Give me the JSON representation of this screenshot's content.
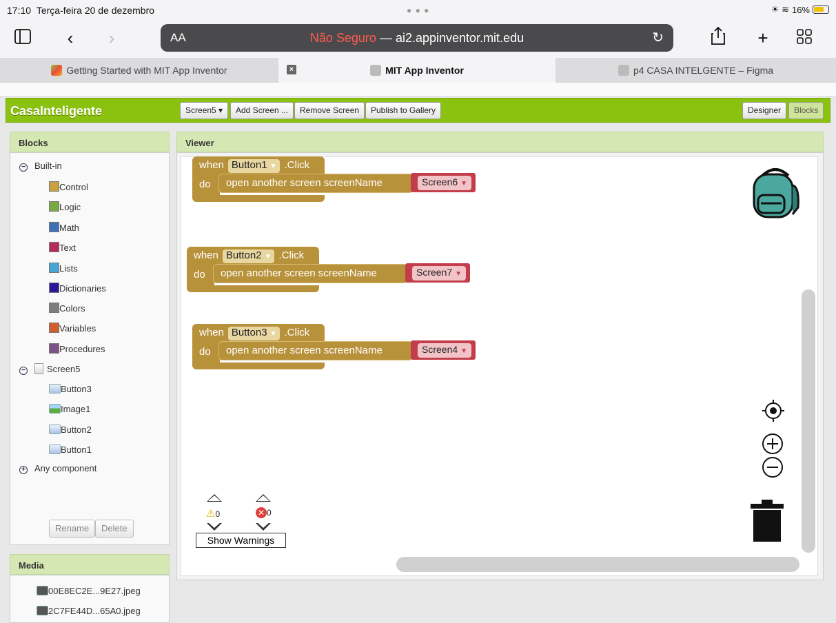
{
  "status_bar": {
    "time": "17:10",
    "date": "Terça-feira 20 de dezembro",
    "battery": "16%"
  },
  "browser": {
    "address_prefix": "AA",
    "not_secure": "Não Seguro",
    "separator": " — ",
    "url": "ai2.appinventor.mit.edu",
    "tabs": [
      {
        "label": "Getting Started with MIT App Inventor"
      },
      {
        "label": "MIT App Inventor"
      },
      {
        "label": "p4 CASA INTELGENTE – Figma"
      }
    ]
  },
  "app": {
    "project_name": "CasaInteligente",
    "screen_selector": "Screen5 ▾",
    "add_screen": "Add Screen ...",
    "remove_screen": "Remove Screen",
    "publish": "Publish to Gallery",
    "designer": "Designer",
    "blocks": "Blocks"
  },
  "blocks_panel": {
    "title": "Blocks",
    "builtin": "Built-in",
    "builtin_items": [
      {
        "label": "Control",
        "color": "#c9a23e"
      },
      {
        "label": "Logic",
        "color": "#77ab41"
      },
      {
        "label": "Math",
        "color": "#3f71b5"
      },
      {
        "label": "Text",
        "color": "#b32d5e"
      },
      {
        "label": "Lists",
        "color": "#49a6d4"
      },
      {
        "label": "Dictionaries",
        "color": "#2d1799"
      },
      {
        "label": "Colors",
        "color": "#7d7d7d"
      },
      {
        "label": "Variables",
        "color": "#d05f2d"
      },
      {
        "label": "Procedures",
        "color": "#7c5385"
      }
    ],
    "screen": "Screen5",
    "components": [
      "Button3",
      "Image1",
      "Button2",
      "Button1"
    ],
    "any_component": "Any component",
    "rename": "Rename",
    "delete": "Delete"
  },
  "media_panel": {
    "title": "Media",
    "files": [
      "00E8EC2E...9E27.jpeg",
      "2C7FE44D...65A0.jpeg"
    ]
  },
  "viewer": {
    "title": "Viewer",
    "blocks": [
      {
        "when": "when",
        "component": "Button1",
        "event": ".Click",
        "do": "do",
        "action": "open another screen  screenName",
        "screen": "Screen6"
      },
      {
        "when": "when",
        "component": "Button2",
        "event": ".Click",
        "do": "do",
        "action": "open another screen  screenName",
        "screen": "Screen7"
      },
      {
        "when": "when",
        "component": "Button3",
        "event": ".Click",
        "do": "do",
        "action": "open another screen  screenName",
        "screen": "Screen4"
      }
    ],
    "warnings_count": "0",
    "errors_count": "0",
    "show_warnings": "Show Warnings"
  }
}
